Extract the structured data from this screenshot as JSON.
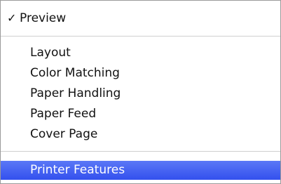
{
  "menu": {
    "checked": {
      "check_glyph": "✓",
      "label": "Preview"
    },
    "items": [
      {
        "label": "Layout"
      },
      {
        "label": "Color Matching"
      },
      {
        "label": "Paper Handling"
      },
      {
        "label": "Paper Feed"
      },
      {
        "label": "Cover Page"
      }
    ],
    "selected": {
      "label": "Printer Features"
    },
    "selected_color": "#3d5cf2"
  }
}
